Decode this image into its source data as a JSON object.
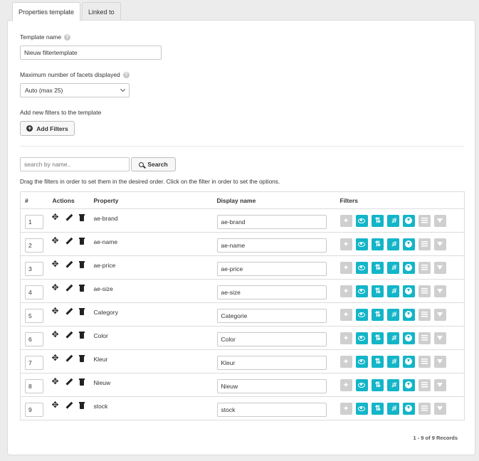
{
  "tabs": [
    {
      "label": "Properties template",
      "active": true
    },
    {
      "label": "Linked to",
      "active": false
    }
  ],
  "form": {
    "template_name_label": "Template name",
    "template_name_value": "Nieuw filtertemplate",
    "max_facets_label": "Maximum number of facets displayed",
    "max_facets_value": "Auto (max 25)",
    "add_filters_label": "Add new filters to the template",
    "add_filters_button": "Add Filters"
  },
  "search": {
    "placeholder": "search by name..",
    "button": "Search"
  },
  "instructions": "Drag the filters in order to set them in the desired order. Click on the filter in order to set the options.",
  "table": {
    "headers": {
      "num": "#",
      "actions": "Actions",
      "property": "Property",
      "display": "Display name",
      "filters": "Filters"
    },
    "rows": [
      {
        "num": "1",
        "property": "ae-brand",
        "display": "ae-brand"
      },
      {
        "num": "2",
        "property": "ae-name",
        "display": "ae-name"
      },
      {
        "num": "3",
        "property": "ae-price",
        "display": "ae-price"
      },
      {
        "num": "4",
        "property": "ae-size",
        "display": "ae-size"
      },
      {
        "num": "5",
        "property": "Category",
        "display": "Categorie"
      },
      {
        "num": "6",
        "property": "Color",
        "display": "Color"
      },
      {
        "num": "7",
        "property": "Kleur",
        "display": "Kleur"
      },
      {
        "num": "8",
        "property": "Nieuw",
        "display": "Nieuw"
      },
      {
        "num": "9",
        "property": "stock",
        "display": "stock"
      }
    ],
    "filter_icons": [
      {
        "name": "sparkle-icon",
        "state": "off"
      },
      {
        "name": "eye-icon",
        "state": "on"
      },
      {
        "name": "sort-arrows-icon",
        "state": "on"
      },
      {
        "name": "sort-number-icon",
        "state": "on"
      },
      {
        "name": "heart-icon",
        "state": "on"
      },
      {
        "name": "list-icon",
        "state": "off"
      },
      {
        "name": "funnel-icon",
        "state": "off"
      }
    ],
    "colors": {
      "on": "#13b5c8",
      "off": "#cfcfcf"
    }
  },
  "records": "1 - 9 of 9 Records"
}
